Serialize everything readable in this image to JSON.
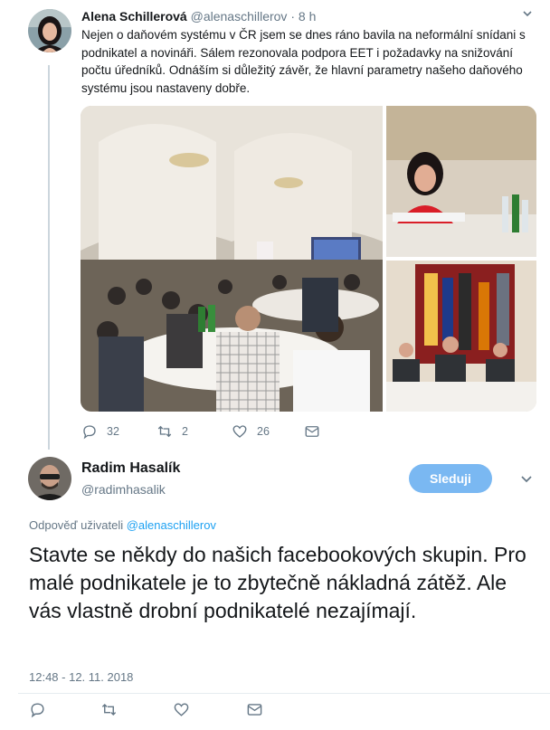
{
  "parent_tweet": {
    "author_name": "Alena Schillerová",
    "author_handle": "@alenaschillerov",
    "separator": "·",
    "time": "8 h",
    "text": "Nejen o daňovém systému v ČR jsem se dnes ráno bavila na neformální snídani s podnikatel a novináři. Sálem rezonovala podpora EET i požadavky na snižování počtu úředníků. Odnáším si důležitý závěr, že hlavní parametry našeho daňového systému jsou nastaveny dobře.",
    "reply_count": "32",
    "retweet_count": "2",
    "like_count": "26"
  },
  "reply_tweet": {
    "author_name": "Radim Hasalík",
    "author_handle": "@radimhasalik",
    "follow_label": "Sleduji",
    "replying_prefix": "Odpověď uživateli",
    "replying_to": "@alenaschillerov",
    "text": "Stavte se někdy do našich facebookových skupin. Pro malé podnikatele je to zbytečně nákladná zátěž. Ale vás vlastně drobní podnikatelé nezajímají.",
    "timestamp": "12:48 - 12. 11. 2018"
  },
  "colors": {
    "accent": "#1da1f2",
    "follow_button": "#7ab8f2",
    "muted_text": "#657786",
    "thread_line": "#ccd6dd",
    "like_icon": "#657786",
    "retweet_icon": "#657786"
  },
  "icons": {
    "reply": "speech-bubble-icon",
    "retweet": "retweet-arrows-icon",
    "like": "heart-outline-icon",
    "message": "envelope-icon",
    "menu": "chevron-down-icon"
  }
}
